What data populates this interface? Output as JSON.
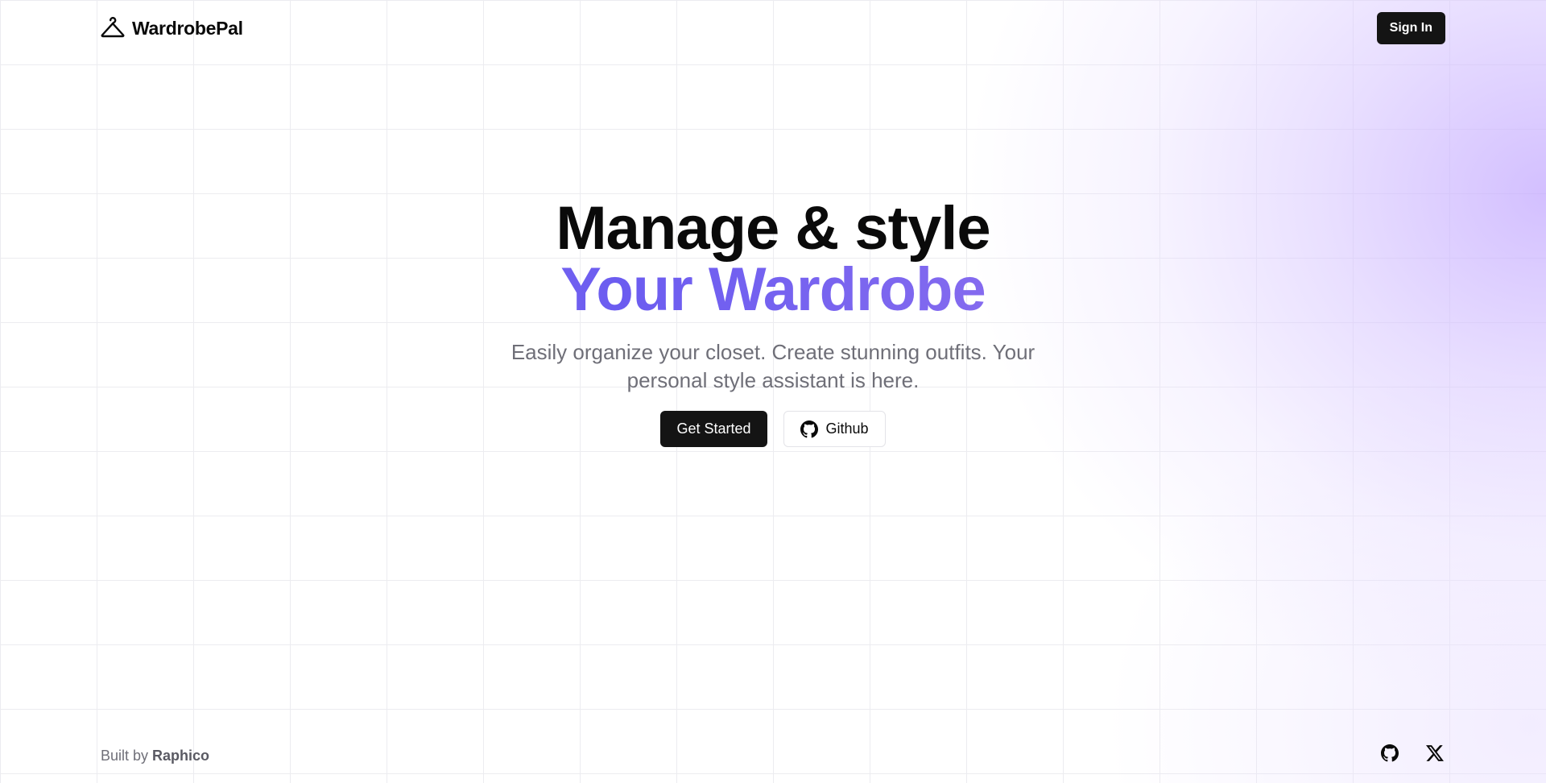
{
  "header": {
    "brand": "WardrobePal",
    "brand_icon": "hanger-icon",
    "sign_in_label": "Sign In"
  },
  "hero": {
    "title_line1": "Manage & style",
    "title_line2": "Your Wardrobe",
    "subtitle": "Easily organize your closet. Create stunning outfits. Your personal style assistant is here.",
    "get_started_label": "Get Started",
    "github_label": "Github",
    "github_icon": "github-icon"
  },
  "footer": {
    "built_by_prefix": "Built by",
    "author": "Raphico",
    "icons": [
      "github-icon",
      "x-icon"
    ]
  },
  "colors": {
    "primary_button": "#141414",
    "gradient_start": "#a98af5",
    "gradient_mid": "#6b5cf0",
    "gradient_end": "#b784f3",
    "glow": "#c4aaff",
    "muted_text": "#6f6f78"
  }
}
